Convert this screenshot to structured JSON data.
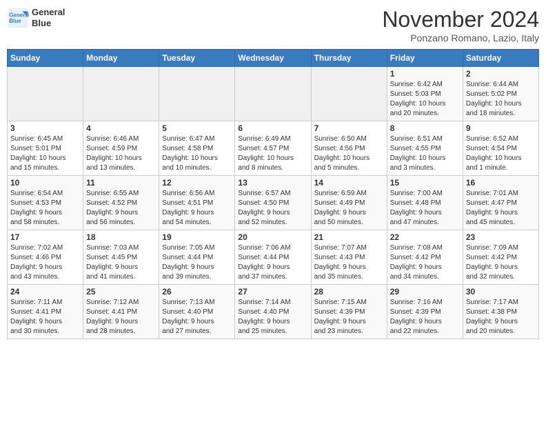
{
  "header": {
    "logo_line1": "General",
    "logo_line2": "Blue",
    "month": "November 2024",
    "location": "Ponzano Romano, Lazio, Italy"
  },
  "weekdays": [
    "Sunday",
    "Monday",
    "Tuesday",
    "Wednesday",
    "Thursday",
    "Friday",
    "Saturday"
  ],
  "weeks": [
    [
      {
        "day": "",
        "info": ""
      },
      {
        "day": "",
        "info": ""
      },
      {
        "day": "",
        "info": ""
      },
      {
        "day": "",
        "info": ""
      },
      {
        "day": "",
        "info": ""
      },
      {
        "day": "1",
        "info": "Sunrise: 6:42 AM\nSunset: 5:03 PM\nDaylight: 10 hours\nand 20 minutes."
      },
      {
        "day": "2",
        "info": "Sunrise: 6:44 AM\nSunset: 5:02 PM\nDaylight: 10 hours\nand 18 minutes."
      }
    ],
    [
      {
        "day": "3",
        "info": "Sunrise: 6:45 AM\nSunset: 5:01 PM\nDaylight: 10 hours\nand 15 minutes."
      },
      {
        "day": "4",
        "info": "Sunrise: 6:46 AM\nSunset: 4:59 PM\nDaylight: 10 hours\nand 13 minutes."
      },
      {
        "day": "5",
        "info": "Sunrise: 6:47 AM\nSunset: 4:58 PM\nDaylight: 10 hours\nand 10 minutes."
      },
      {
        "day": "6",
        "info": "Sunrise: 6:49 AM\nSunset: 4:57 PM\nDaylight: 10 hours\nand 8 minutes."
      },
      {
        "day": "7",
        "info": "Sunrise: 6:50 AM\nSunset: 4:56 PM\nDaylight: 10 hours\nand 5 minutes."
      },
      {
        "day": "8",
        "info": "Sunrise: 6:51 AM\nSunset: 4:55 PM\nDaylight: 10 hours\nand 3 minutes."
      },
      {
        "day": "9",
        "info": "Sunrise: 6:52 AM\nSunset: 4:54 PM\nDaylight: 10 hours\nand 1 minute."
      }
    ],
    [
      {
        "day": "10",
        "info": "Sunrise: 6:54 AM\nSunset: 4:53 PM\nDaylight: 9 hours\nand 58 minutes."
      },
      {
        "day": "11",
        "info": "Sunrise: 6:55 AM\nSunset: 4:52 PM\nDaylight: 9 hours\nand 56 minutes."
      },
      {
        "day": "12",
        "info": "Sunrise: 6:56 AM\nSunset: 4:51 PM\nDaylight: 9 hours\nand 54 minutes."
      },
      {
        "day": "13",
        "info": "Sunrise: 6:57 AM\nSunset: 4:50 PM\nDaylight: 9 hours\nand 52 minutes."
      },
      {
        "day": "14",
        "info": "Sunrise: 6:59 AM\nSunset: 4:49 PM\nDaylight: 9 hours\nand 50 minutes."
      },
      {
        "day": "15",
        "info": "Sunrise: 7:00 AM\nSunset: 4:48 PM\nDaylight: 9 hours\nand 47 minutes."
      },
      {
        "day": "16",
        "info": "Sunrise: 7:01 AM\nSunset: 4:47 PM\nDaylight: 9 hours\nand 45 minutes."
      }
    ],
    [
      {
        "day": "17",
        "info": "Sunrise: 7:02 AM\nSunset: 4:46 PM\nDaylight: 9 hours\nand 43 minutes."
      },
      {
        "day": "18",
        "info": "Sunrise: 7:03 AM\nSunset: 4:45 PM\nDaylight: 9 hours\nand 41 minutes."
      },
      {
        "day": "19",
        "info": "Sunrise: 7:05 AM\nSunset: 4:44 PM\nDaylight: 9 hours\nand 39 minutes."
      },
      {
        "day": "20",
        "info": "Sunrise: 7:06 AM\nSunset: 4:44 PM\nDaylight: 9 hours\nand 37 minutes."
      },
      {
        "day": "21",
        "info": "Sunrise: 7:07 AM\nSunset: 4:43 PM\nDaylight: 9 hours\nand 35 minutes."
      },
      {
        "day": "22",
        "info": "Sunrise: 7:08 AM\nSunset: 4:42 PM\nDaylight: 9 hours\nand 34 minutes."
      },
      {
        "day": "23",
        "info": "Sunrise: 7:09 AM\nSunset: 4:42 PM\nDaylight: 9 hours\nand 32 minutes."
      }
    ],
    [
      {
        "day": "24",
        "info": "Sunrise: 7:11 AM\nSunset: 4:41 PM\nDaylight: 9 hours\nand 30 minutes."
      },
      {
        "day": "25",
        "info": "Sunrise: 7:12 AM\nSunset: 4:41 PM\nDaylight: 9 hours\nand 28 minutes."
      },
      {
        "day": "26",
        "info": "Sunrise: 7:13 AM\nSunset: 4:40 PM\nDaylight: 9 hours\nand 27 minutes."
      },
      {
        "day": "27",
        "info": "Sunrise: 7:14 AM\nSunset: 4:40 PM\nDaylight: 9 hours\nand 25 minutes."
      },
      {
        "day": "28",
        "info": "Sunrise: 7:15 AM\nSunset: 4:39 PM\nDaylight: 9 hours\nand 23 minutes."
      },
      {
        "day": "29",
        "info": "Sunrise: 7:16 AM\nSunset: 4:39 PM\nDaylight: 9 hours\nand 22 minutes."
      },
      {
        "day": "30",
        "info": "Sunrise: 7:17 AM\nSunset: 4:38 PM\nDaylight: 9 hours\nand 20 minutes."
      }
    ]
  ]
}
